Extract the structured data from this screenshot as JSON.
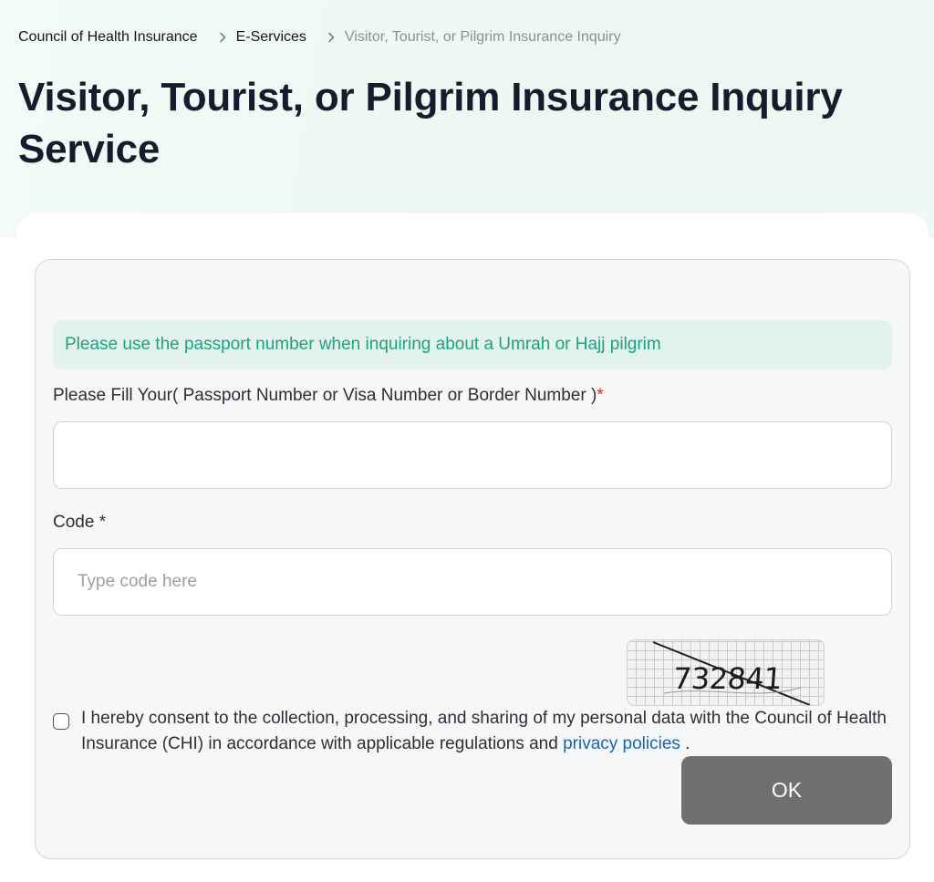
{
  "breadcrumb": {
    "items": [
      {
        "label": "Council of Health Insurance"
      },
      {
        "label": "E-Services"
      },
      {
        "label": "Visitor, Tourist, or Pilgrim Insurance Inquiry"
      }
    ],
    "separator_icon": "chevron-right-icon"
  },
  "page": {
    "title": "Visitor, Tourist, or Pilgrim Insurance Inquiry Service"
  },
  "form": {
    "notice": "Please use the passport number when inquiring about a Umrah or Hajj pilgrim",
    "id_field": {
      "label": "Please Fill Your( Passport Number or Visa Number or Border Number )",
      "required_mark": "*",
      "value": "",
      "placeholder": ""
    },
    "code_field": {
      "label": "Code",
      "required_mark": "*",
      "value": "",
      "placeholder": "Type code here"
    },
    "captcha": {
      "text": "732841"
    },
    "consent": {
      "checked": false,
      "text_before": "I hereby consent to the collection, processing, and sharing of my personal data with the Council of Health Insurance (CHI) in accordance with applicable regulations and ",
      "link_text": "privacy policies",
      "text_after": " ."
    },
    "submit_label": "OK"
  },
  "colors": {
    "notice_text": "#1aa37e",
    "notice_bg": "#e4f2ee",
    "link": "#1266b3",
    "required": "#e02424",
    "button_bg": "#707070"
  }
}
